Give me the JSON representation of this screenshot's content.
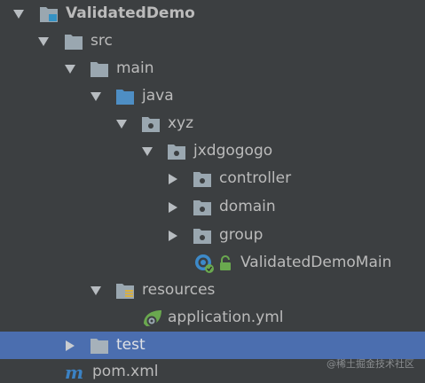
{
  "tree": {
    "project": {
      "label": "ValidatedDemo"
    },
    "src": {
      "label": "src"
    },
    "main": {
      "label": "main"
    },
    "java": {
      "label": "java"
    },
    "xyz": {
      "label": "xyz"
    },
    "jxdgogogo": {
      "label": "jxdgogogo"
    },
    "controller": {
      "label": "controller"
    },
    "domain": {
      "label": "domain"
    },
    "group": {
      "label": "group"
    },
    "main_class": {
      "label": "ValidatedDemoMain"
    },
    "resources": {
      "label": "resources"
    },
    "application_yml": {
      "label": "application.yml"
    },
    "test": {
      "label": "test"
    },
    "pom": {
      "label": "pom.xml"
    }
  },
  "watermark": "@稀土掘金技术社区",
  "colors": {
    "background": "#3c3f41",
    "selection": "#4b6eaf",
    "text": "#bbbbbb",
    "folder": "#9aa7b0",
    "source_folder": "#4e8ec4",
    "maven": "#3b82c4",
    "spring_green": "#6aa84f"
  }
}
